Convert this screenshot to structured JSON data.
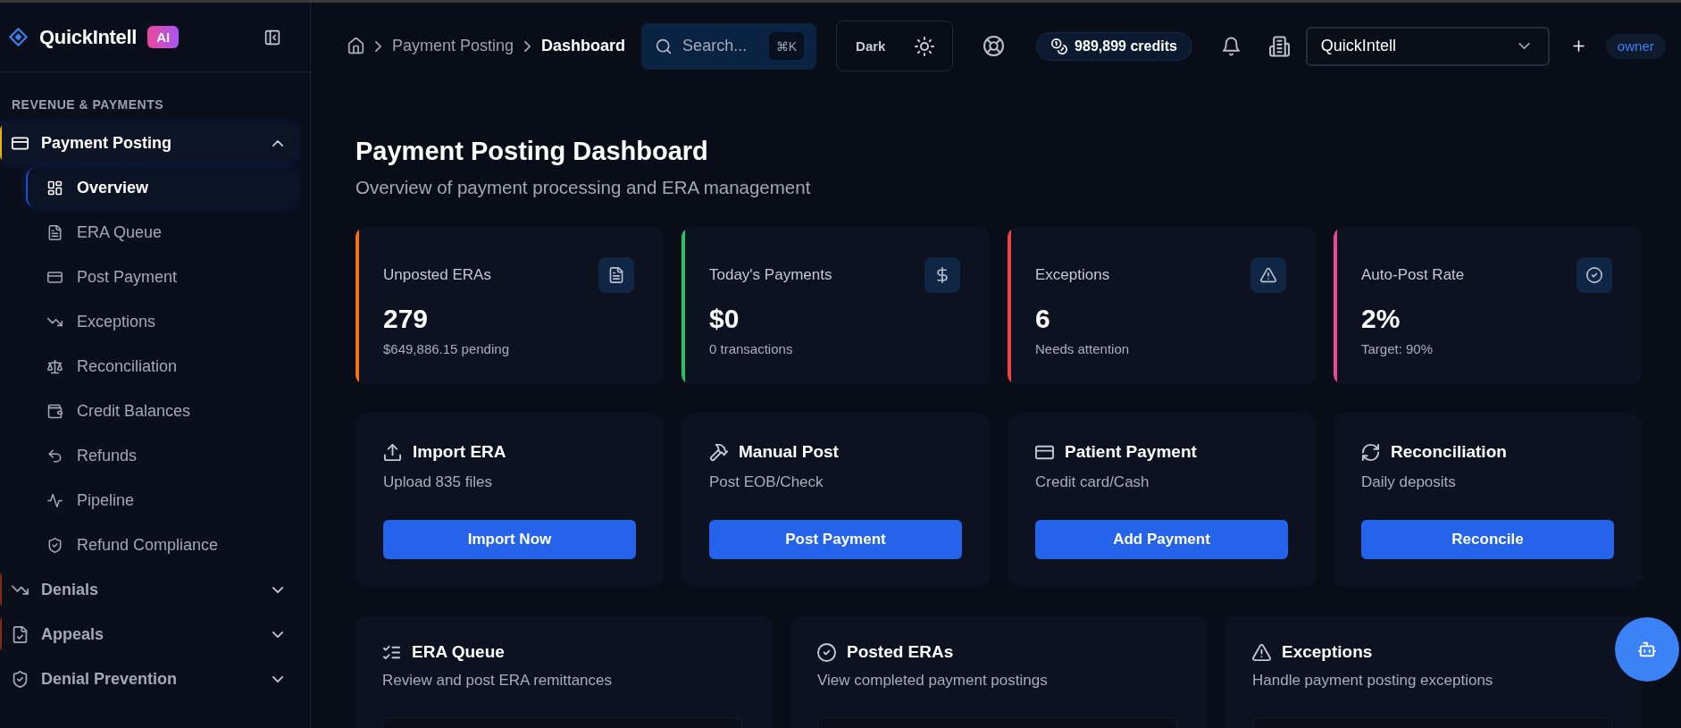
{
  "sidebar": {
    "brand": {
      "name": "QuickIntell",
      "badge": "AI"
    },
    "section_title": "REVENUE & PAYMENTS",
    "items": [
      {
        "label": "Payment Posting",
        "selected": true,
        "expanded": true,
        "color": "#eab308",
        "children": [
          {
            "label": "Overview",
            "selected": true
          },
          {
            "label": "ERA Queue",
            "selected": false
          },
          {
            "label": "Post Payment",
            "selected": false
          },
          {
            "label": "Exceptions",
            "selected": false
          },
          {
            "label": "Reconciliation",
            "selected": false
          },
          {
            "label": "Credit Balances",
            "selected": false
          },
          {
            "label": "Refunds",
            "selected": false
          },
          {
            "label": "Pipeline",
            "selected": false
          },
          {
            "label": "Refund Compliance",
            "selected": false
          }
        ]
      },
      {
        "label": "Denials",
        "selected": false,
        "expanded": false,
        "color": "#7c2d12"
      },
      {
        "label": "Appeals",
        "selected": false,
        "expanded": false,
        "color": "#7c2d12"
      },
      {
        "label": "Denial Prevention",
        "selected": false,
        "expanded": false
      }
    ]
  },
  "topbar": {
    "breadcrumb": [
      {
        "label": "Payment Posting",
        "current": false
      },
      {
        "label": "Dashboard",
        "current": true
      }
    ],
    "search": {
      "placeholder": "Search...",
      "shortcut": "⌘K"
    },
    "theme_toggle": {
      "label": "Dark"
    },
    "credits": "989,899 credits",
    "organization_select": {
      "value": "QuickIntell"
    },
    "role_badge": "owner"
  },
  "page": {
    "title": "Payment Posting Dashboard",
    "subtitle": "Overview of payment processing and ERA management",
    "stats": [
      {
        "label": "Unposted ERAs",
        "value": "279",
        "note": "$649,886.15 pending",
        "color": "#f97316"
      },
      {
        "label": "Today's Payments",
        "value": "$0",
        "note": "0 transactions",
        "color": "#22c55e"
      },
      {
        "label": "Exceptions",
        "value": "6",
        "note": "Needs attention",
        "color": "#ef4444"
      },
      {
        "label": "Auto-Post Rate",
        "value": "2%",
        "note": "Target: 90%",
        "color": "#ec4899"
      }
    ],
    "actions": [
      {
        "title": "Import ERA",
        "description": "Upload 835 files",
        "button": "Import Now"
      },
      {
        "title": "Manual Post",
        "description": "Post EOB/Check",
        "button": "Post Payment"
      },
      {
        "title": "Patient Payment",
        "description": "Credit card/Cash",
        "button": "Add Payment"
      },
      {
        "title": "Reconciliation",
        "description": "Daily deposits",
        "button": "Reconcile"
      }
    ],
    "sections": [
      {
        "title": "ERA Queue",
        "description": "Review and post ERA remittances"
      },
      {
        "title": "Posted ERAs",
        "description": "View completed payment postings"
      },
      {
        "title": "Exceptions",
        "description": "Handle payment posting exceptions"
      }
    ]
  }
}
